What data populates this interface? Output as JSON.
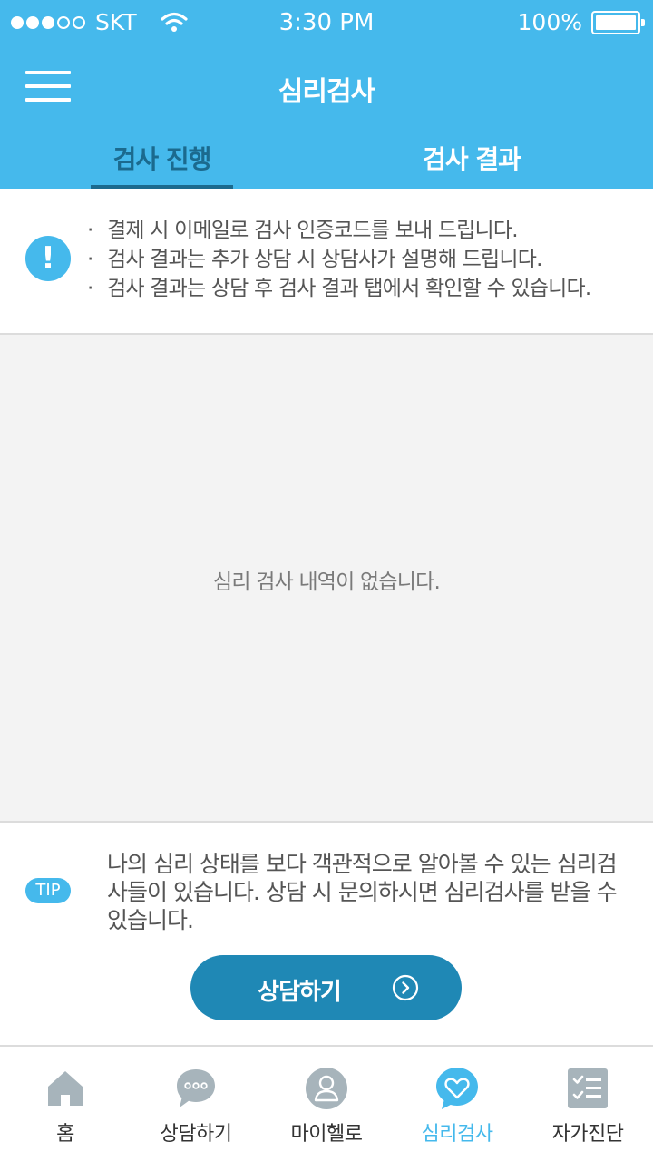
{
  "status_bar": {
    "carrier": "SKT",
    "time": "3:30 PM",
    "battery": "100%",
    "signal_bars_filled": 3,
    "signal_bars_total": 5
  },
  "header": {
    "title": "심리검사",
    "menu_icon": "hamburger-menu-icon"
  },
  "tabs": [
    {
      "label": "검사 진행",
      "active": true
    },
    {
      "label": "검사  결과",
      "active": false
    }
  ],
  "notice": {
    "icon": "exclamation-icon",
    "bullet": "·",
    "lines": [
      "결제 시 이메일로 검사 인증코드를 보내 드립니다.",
      "검사 결과는 추가 상담 시 상담사가 설명해 드립니다.",
      "검사 결과는 상담 후 검사 결과 탭에서 확인할 수 있습니다."
    ]
  },
  "empty_state": {
    "message": "심리 검사 내역이 없습니다."
  },
  "tip": {
    "badge": "TIP",
    "text": "나의 심리 상태를 보다 객관적으로 알아볼 수 있는 심리검사들이 있습니다. 상담 시 문의하시면 심리검사를 받을 수 있습니다."
  },
  "consult_button": {
    "label": "상담하기",
    "icon": "chevron-right-circle-icon"
  },
  "tab_bar": {
    "items": [
      {
        "label": "홈",
        "icon": "home-icon",
        "active": false
      },
      {
        "label": "상담하기",
        "icon": "chat-bubble-icon",
        "active": false
      },
      {
        "label": "마이헬로",
        "icon": "user-icon",
        "active": false
      },
      {
        "label": "심리검사",
        "icon": "heart-bubble-icon",
        "active": true
      },
      {
        "label": "자가진단",
        "icon": "checklist-icon",
        "active": false
      }
    ]
  },
  "colors": {
    "primary": "#45b9ec",
    "tab_active": "#1b6a8e",
    "button": "#1f88b5",
    "icon_gray": "#a7b4bb"
  }
}
